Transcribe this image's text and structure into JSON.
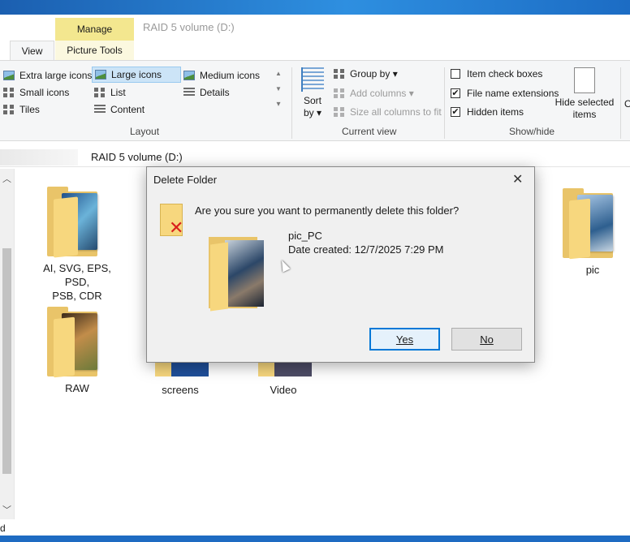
{
  "window": {
    "title": "RAID 5 volume (D:)",
    "contextual_tab": "Manage",
    "tabs": [
      "View",
      "Picture Tools"
    ]
  },
  "ribbon": {
    "layout": {
      "items": [
        "Extra large icons",
        "Large icons",
        "Medium icons",
        "Small icons",
        "List",
        "Details",
        "Tiles",
        "Content"
      ],
      "selected": "Large icons",
      "group_label": "Layout"
    },
    "current_view": {
      "sort_label": "Sort",
      "sort_by": "by",
      "group_by": "Group by",
      "add_columns": "Add columns",
      "size_columns": "Size all columns to fit",
      "group_label": "Current view"
    },
    "show_hide": {
      "item_check_boxes": "Item check boxes",
      "file_name_extensions": "File name extensions",
      "hidden_items": "Hidden items",
      "hide_selected_1": "Hide selected",
      "hide_selected_2": "items",
      "group_label": "Show/hide",
      "checks": {
        "item_check_boxes": false,
        "file_name_extensions": true,
        "hidden_items": true
      }
    },
    "overflow_letter": "O"
  },
  "address": {
    "path": "RAID 5 volume (D:)"
  },
  "folders": {
    "ai": {
      "label_1": "AI, SVG, EPS, PSD,",
      "label_2": "PSB, CDR"
    },
    "pic": {
      "label": "pic"
    },
    "raw": {
      "label": "RAW"
    },
    "screens": {
      "label": "screens"
    },
    "video": {
      "label": "Video"
    }
  },
  "dialog": {
    "title": "Delete Folder",
    "question": "Are you sure you want to permanently delete this folder?",
    "folder_name": "pic_PC",
    "date_created": "Date created: 12/7/2025 7:29 PM",
    "yes_label": "Yes",
    "no_label": "No"
  },
  "status": {
    "fragment": "d"
  },
  "colors": {
    "accent": "#0078d7",
    "folder": "#f7d77e",
    "manage_tab": "#f3e78f",
    "danger": "#d9201c"
  }
}
